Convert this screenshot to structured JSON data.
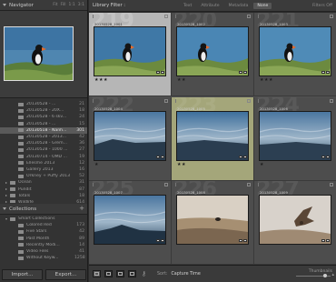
{
  "navigator": {
    "title": "Navigator",
    "modes": [
      "Fit",
      "Fill",
      "1:1",
      "3:1"
    ]
  },
  "folders": [
    {
      "name": "20130528 - ...",
      "count": "21",
      "level": 1
    },
    {
      "name": "20130528 - 20X...",
      "count": "18",
      "level": 1
    },
    {
      "name": "20130528 - 6 skv...",
      "count": "24",
      "level": 1
    },
    {
      "name": "20130528 - ...",
      "count": "15",
      "level": 1
    },
    {
      "name": "20130518 - Nanh...",
      "count": "301",
      "level": 1,
      "selected": true
    },
    {
      "name": "20130528 - 2013...",
      "count": "42",
      "level": 1
    },
    {
      "name": "20130528 - Grem...",
      "count": "36",
      "level": 1
    },
    {
      "name": "20130528 - 1000 ...",
      "count": "27",
      "level": 1
    },
    {
      "name": "20130714 - OMD ...",
      "count": "19",
      "level": 1
    },
    {
      "name": "Ellesme 2013",
      "count": "12",
      "level": 1
    },
    {
      "name": "Gallery 2013",
      "count": "16",
      "level": 1
    },
    {
      "name": "Orkney + Puffy 2013",
      "count": "52",
      "level": 1
    },
    {
      "name": "Ocean",
      "count": "31",
      "level": 0
    },
    {
      "name": "Pundit",
      "count": "87",
      "level": 0
    },
    {
      "name": "Totals",
      "count": "18",
      "level": 0
    },
    {
      "name": "Wildlife",
      "count": "614",
      "level": 0
    }
  ],
  "collections": {
    "title": "Collections",
    "items": [
      {
        "name": "Smart Collections",
        "count": "",
        "level": 0
      },
      {
        "name": "Colored Red",
        "count": "173",
        "level": 1
      },
      {
        "name": "Five Stars",
        "count": "42",
        "level": 1
      },
      {
        "name": "Past Month",
        "count": "89",
        "level": 1
      },
      {
        "name": "Recently Modi...",
        "count": "14",
        "level": 1
      },
      {
        "name": "Video Files",
        "count": "41",
        "level": 1
      },
      {
        "name": "Without Keyw...",
        "count": "1258",
        "level": 1
      }
    ]
  },
  "buttons": {
    "import": "Import...",
    "export": "Export..."
  },
  "filterbar": {
    "label": "Library Filter :",
    "tabs": [
      "Text",
      "Attribute",
      "Metadata",
      "None"
    ],
    "active": "None",
    "right": "Filters Off"
  },
  "grid": {
    "cells": [
      {
        "num": "219",
        "name": "20130528_1001",
        "scene": "puffin",
        "stars": "★★★",
        "state": "selected"
      },
      {
        "num": "220",
        "name": "20130528_1002",
        "scene": "puffin2",
        "stars": "★★",
        "state": ""
      },
      {
        "num": "221",
        "name": "20130528_1003",
        "scene": "puffin3",
        "stars": "★★★",
        "state": ""
      },
      {
        "num": "222",
        "name": "20130528_1004",
        "scene": "sea1",
        "stars": "★",
        "state": ""
      },
      {
        "num": "223",
        "name": "20130528_1005",
        "scene": "sea2",
        "stars": "★★",
        "state": "target"
      },
      {
        "num": "224",
        "name": "20130528_1006",
        "scene": "sea3",
        "stars": "★",
        "state": ""
      },
      {
        "num": "225",
        "name": "20130528_1007",
        "scene": "sea4",
        "stars": "",
        "state": ""
      },
      {
        "num": "226",
        "name": "20130528_1008",
        "scene": "cliff",
        "stars": "",
        "state": ""
      },
      {
        "num": "227",
        "name": "20130528_1009",
        "scene": "bird",
        "stars": "",
        "state": ""
      }
    ]
  },
  "toolbar": {
    "sort_label": "Sort:",
    "sort_value": "Capture Time",
    "thumbnails_label": "Thumbnails"
  }
}
